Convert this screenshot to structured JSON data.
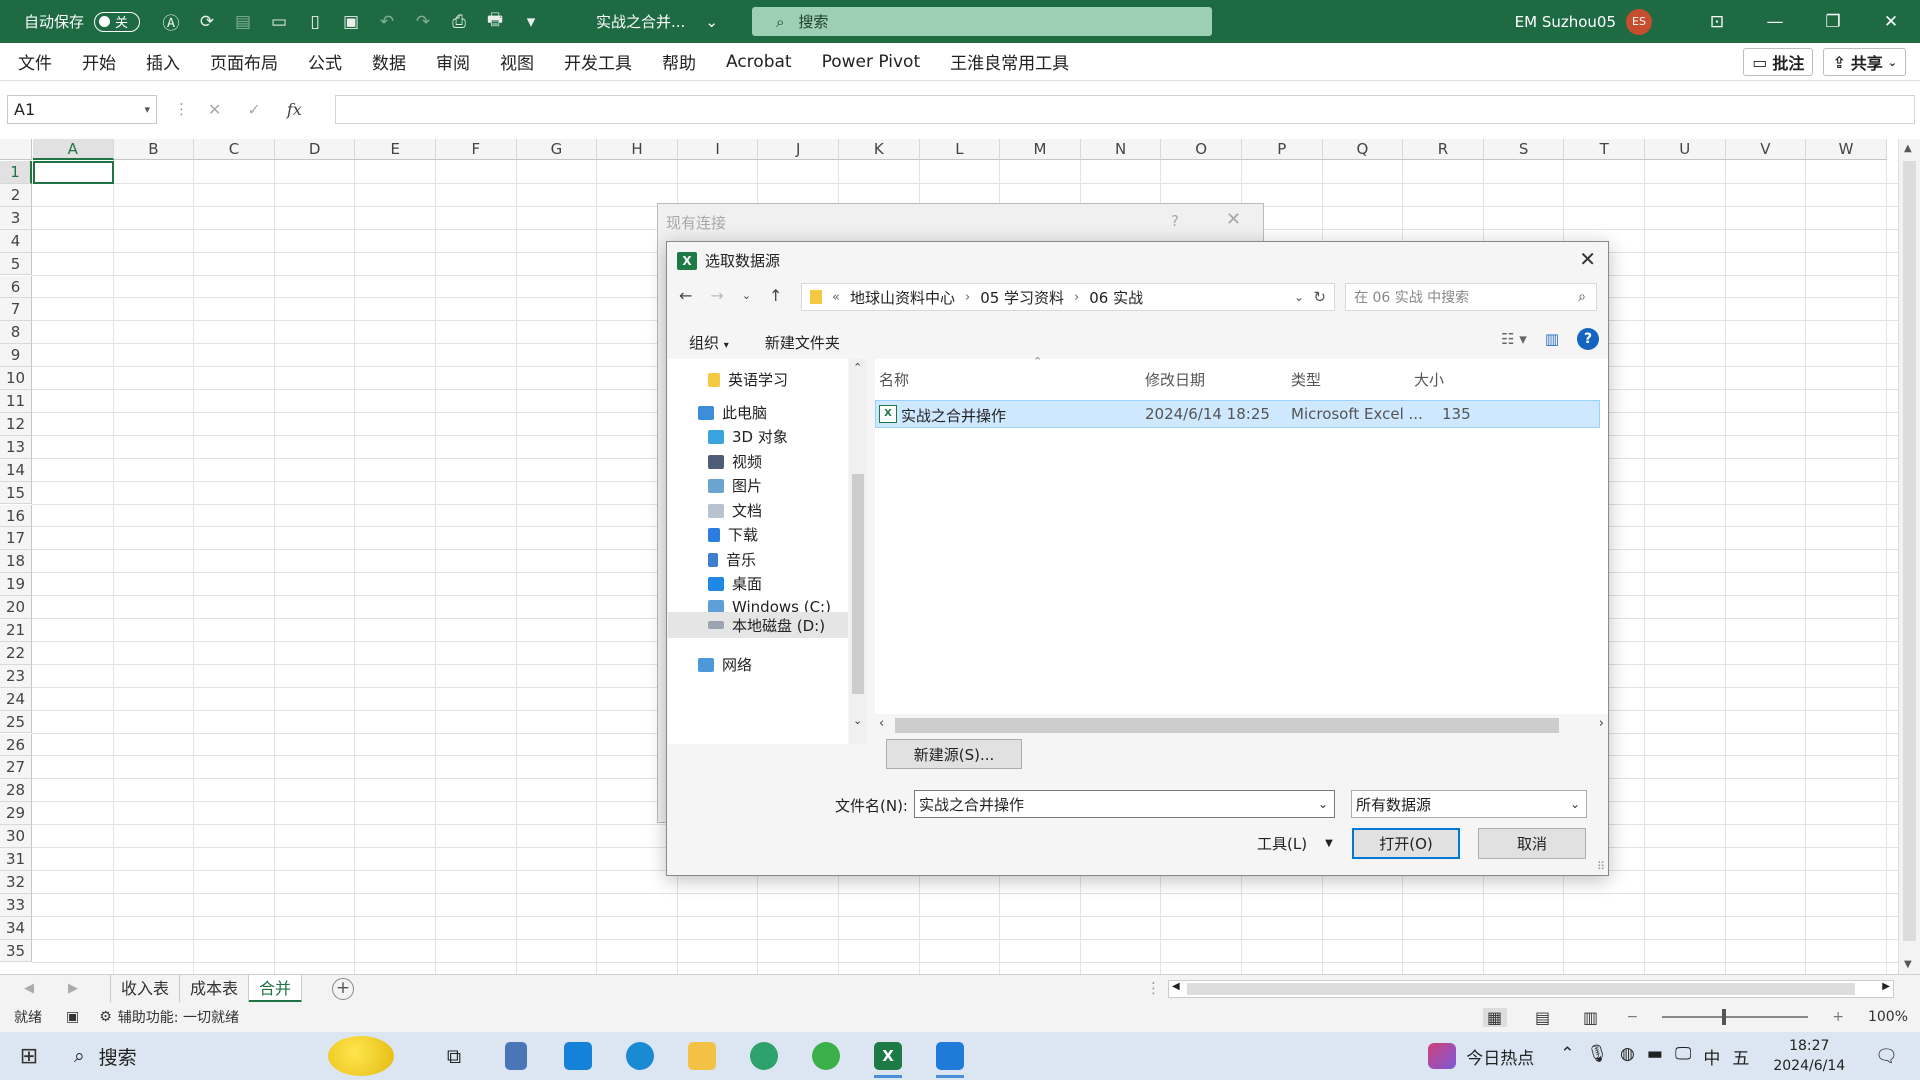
{
  "titlebar": {
    "autosave_label": "自动保存",
    "autosave_state": "关",
    "doc_title": "实战之合并...",
    "search_placeholder": "搜索",
    "user_name": "EM Suzhou05",
    "avatar_initials": "ES"
  },
  "menu": {
    "items": [
      "文件",
      "开始",
      "插入",
      "页面布局",
      "公式",
      "数据",
      "审阅",
      "视图",
      "开发工具",
      "帮助",
      "Acrobat",
      "Power Pivot",
      "王淮良常用工具"
    ],
    "comments_label": "批注",
    "share_label": "共享"
  },
  "formula_bar": {
    "name_box": "A1",
    "formula": ""
  },
  "grid": {
    "columns": [
      "A",
      "B",
      "C",
      "D",
      "E",
      "F",
      "G",
      "H",
      "I",
      "J",
      "K",
      "L",
      "M",
      "N",
      "O",
      "P",
      "Q",
      "R",
      "S",
      "T",
      "U",
      "V",
      "W"
    ],
    "rows": [
      "1",
      "2",
      "3",
      "4",
      "5",
      "6",
      "7",
      "8",
      "9",
      "10",
      "11",
      "12",
      "13",
      "14",
      "15",
      "16",
      "17",
      "18",
      "19",
      "20",
      "21",
      "22",
      "23",
      "24",
      "25",
      "26",
      "27",
      "28",
      "29",
      "30",
      "31",
      "32",
      "33",
      "34",
      "35"
    ]
  },
  "sheets": {
    "tabs": [
      "收入表",
      "成本表",
      "合并"
    ],
    "active": "合并"
  },
  "status": {
    "ready": "就绪",
    "accessibility": "辅助功能: 一切就绪",
    "zoom": "100%"
  },
  "taskbar": {
    "search_label": "搜索",
    "news_label": "今日热点",
    "ime_label": "中",
    "ime_mode": "五",
    "time": "18:27",
    "date": "2024/6/14"
  },
  "back_dialog": {
    "title": "现有连接"
  },
  "dialog": {
    "title": "选取数据源",
    "breadcrumb": [
      "地球山资料中心",
      "05 学习资料",
      "06 实战"
    ],
    "search_placeholder": "在 06 实战 中搜索",
    "organize_label": "组织",
    "new_folder_label": "新建文件夹",
    "tree": [
      {
        "label": "英语学习",
        "icon": "folder-icon"
      },
      {
        "label": "此电脑",
        "icon": "computer-icon"
      },
      {
        "label": "3D 对象",
        "icon": "3d-objects-icon"
      },
      {
        "label": "视频",
        "icon": "video-icon"
      },
      {
        "label": "图片",
        "icon": "pictures-icon"
      },
      {
        "label": "文档",
        "icon": "documents-icon"
      },
      {
        "label": "下载",
        "icon": "download-icon"
      },
      {
        "label": "音乐",
        "icon": "music-icon"
      },
      {
        "label": "桌面",
        "icon": "desktop-icon"
      },
      {
        "label": "Windows  (C:)",
        "icon": "drive-c-icon"
      },
      {
        "label": "本地磁盘 (D:)",
        "icon": "drive-d-icon"
      },
      {
        "label": "网络",
        "icon": "network-icon"
      }
    ],
    "columns": {
      "name": "名称",
      "modified": "修改日期",
      "type": "类型",
      "size": "大小"
    },
    "files": [
      {
        "name": "实战之合并操作",
        "modified": "2024/6/14 18:25",
        "type": "Microsoft Excel ...",
        "size": "135"
      }
    ],
    "new_source_label": "新建源(S)...",
    "filename_label": "文件名(N):",
    "filename_value": "实战之合并操作",
    "filetype_value": "所有数据源",
    "tools_label": "工具(L)",
    "open_label": "打开(O)",
    "cancel_label": "取消"
  },
  "colors": {
    "excel_green": "#1e6b43",
    "accent": "#217346",
    "selection": "#cde8ff"
  }
}
